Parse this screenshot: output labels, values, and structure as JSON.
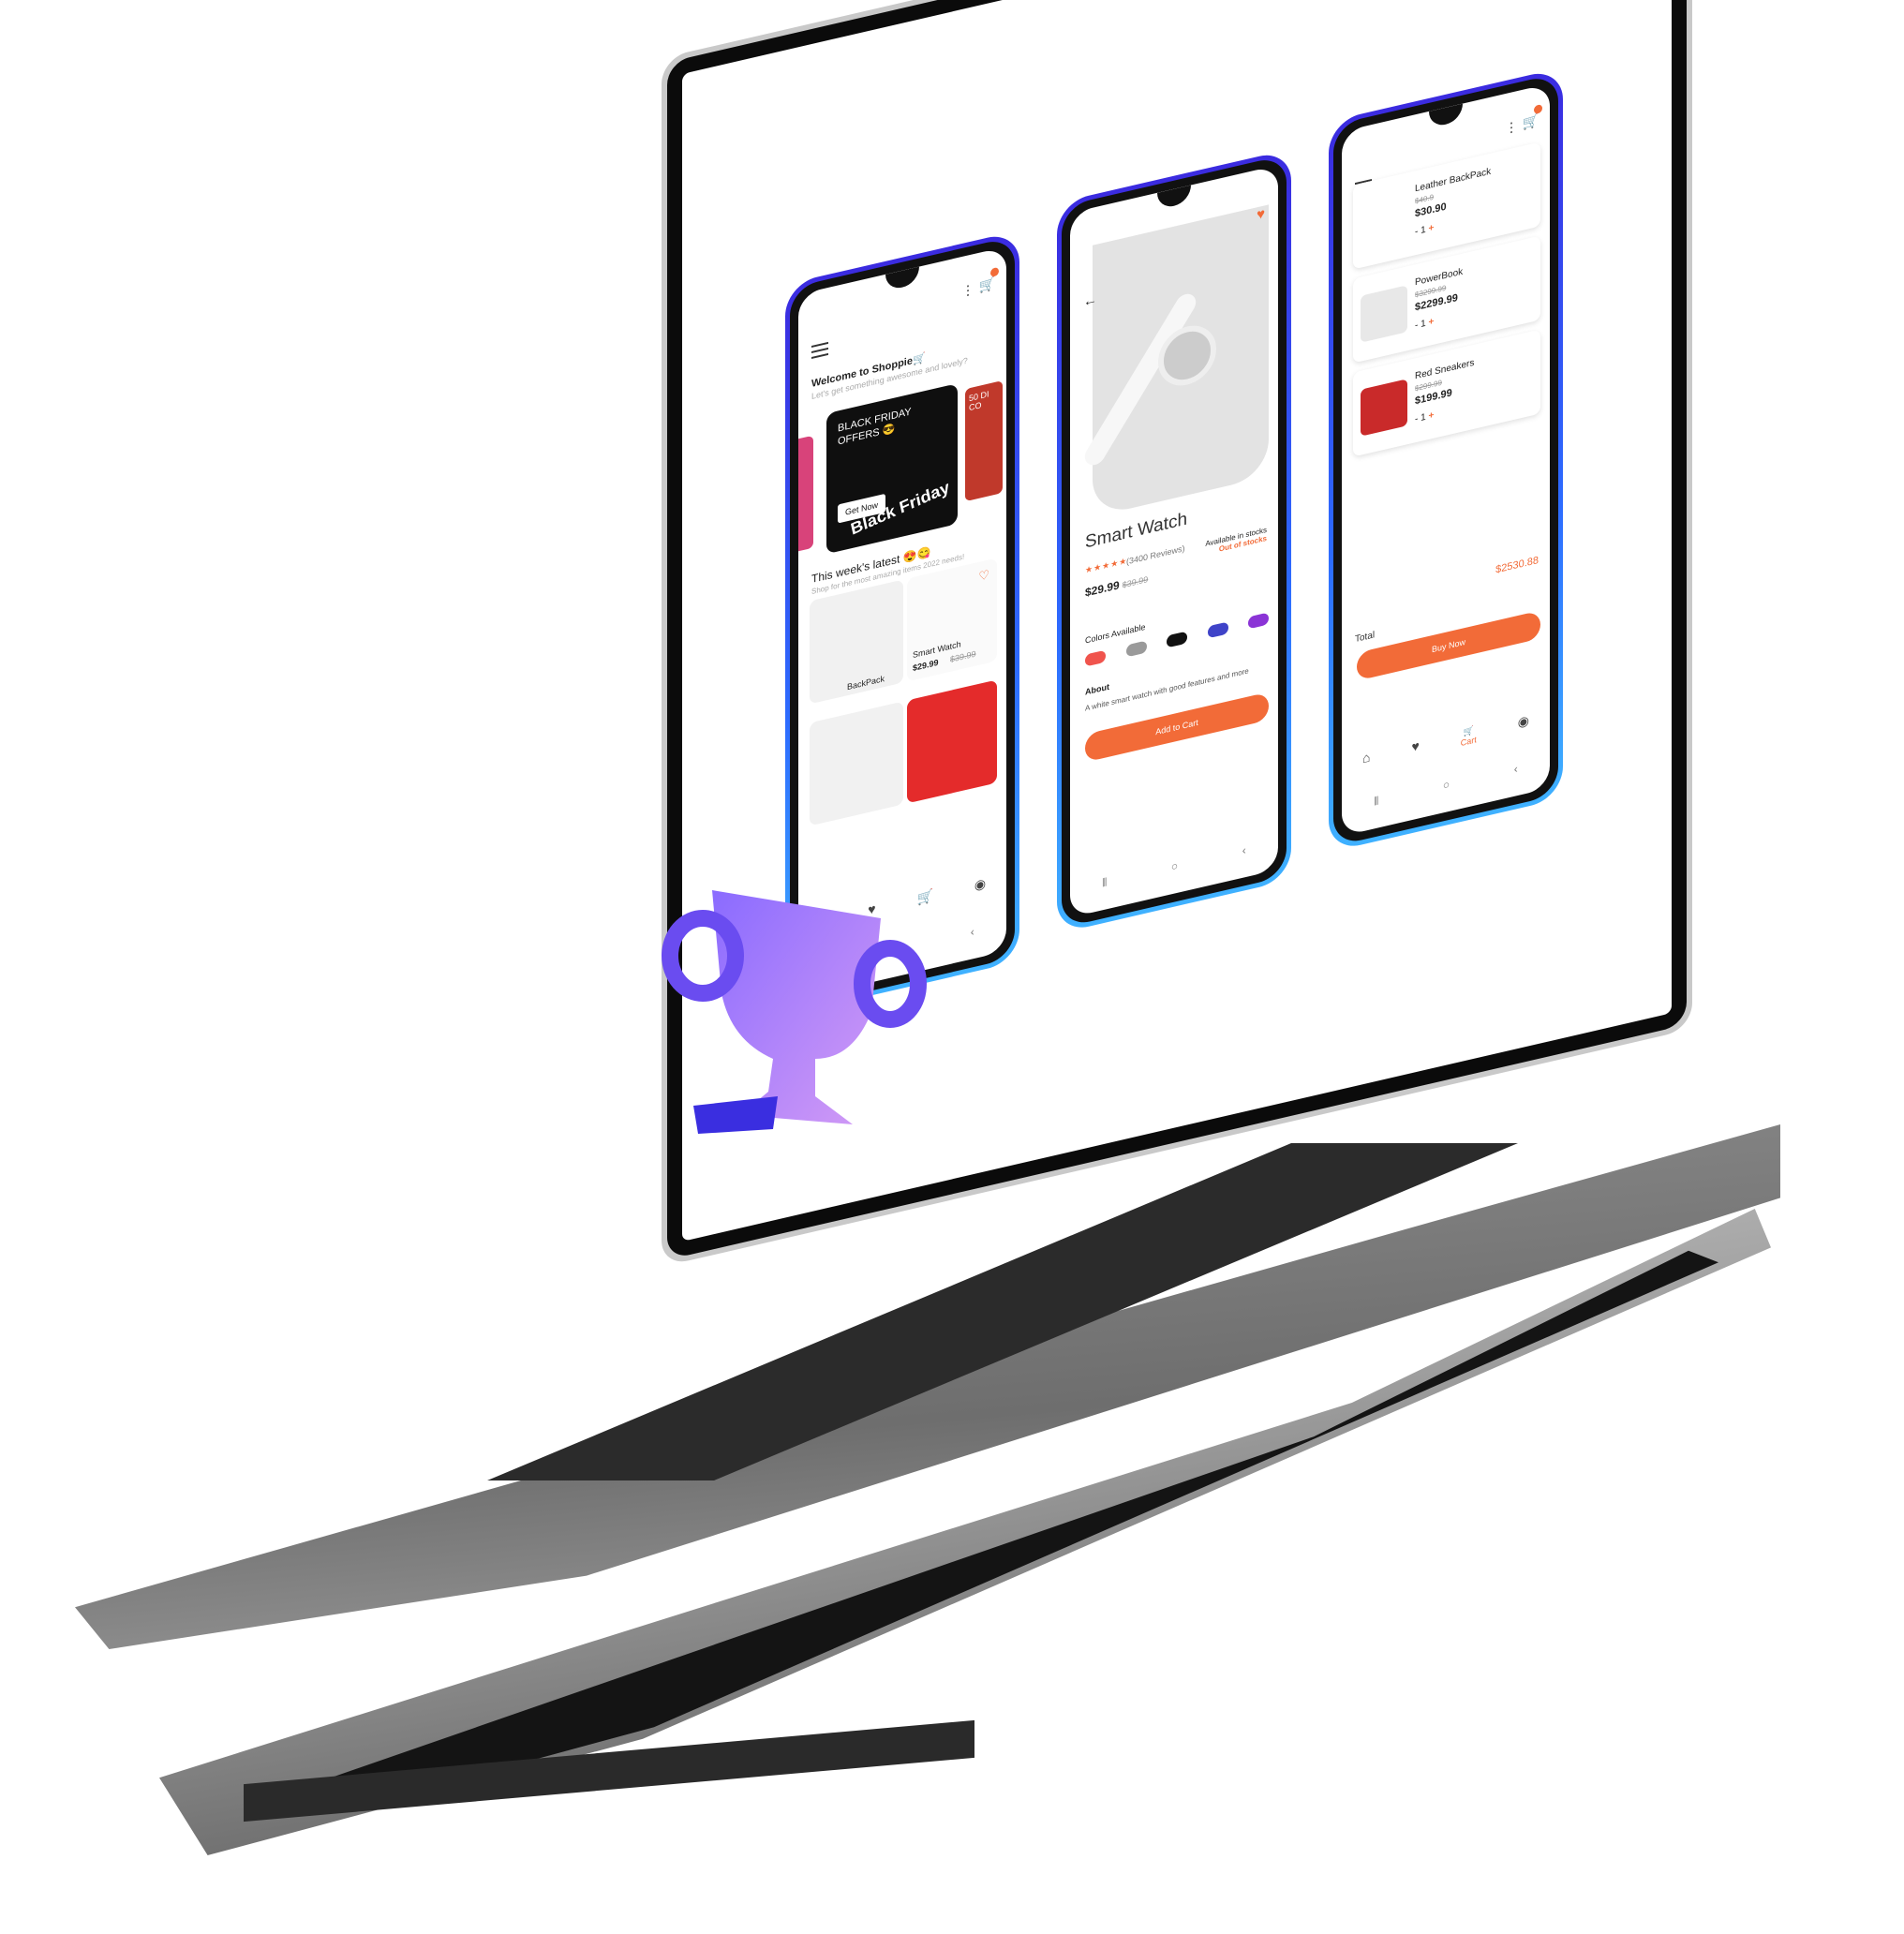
{
  "home": {
    "welcome_title": "Welcome to Shoppie🛒",
    "welcome_sub": "Let's get something awesome and lovely?",
    "banner_text": "BLACK FRIDAY OFFERS 😎",
    "banner_button": "Get Now",
    "banner_badge": "Black Friday",
    "banner_right_text": "50 DI CO",
    "latest_title": "This week's latest 😍😋",
    "latest_sub": "Shop for the most amazing items 2022 needs!",
    "item1_label": "BackPack",
    "item2_name": "Smart Watch",
    "item2_price": "$29.99",
    "item2_old": "$39.99"
  },
  "product": {
    "name": "Smart Watch",
    "stars": "★★★★★",
    "reviews": "(3400 Reviews)",
    "price": "$29.99",
    "old_price": "$39.99",
    "availability": "Available in stocks",
    "stock_status": "Out of stocks",
    "colors_label": "Colors Available",
    "colors": [
      "#f0544d",
      "#9a9a9a",
      "#111111",
      "#3f43c8",
      "#8b34d6"
    ],
    "about_label": "About",
    "about_text": "A white smart watch with good features and more",
    "add_to_cart": "Add to Cart"
  },
  "cart": {
    "items": [
      {
        "name": "Leather BackPack",
        "old": "$40.9",
        "price": "$30.90",
        "qty": "1"
      },
      {
        "name": "PowerBook",
        "old": "$3299.99",
        "price": "$2299.99",
        "qty": "1"
      },
      {
        "name": "Red Sneakers",
        "old": "$299.99",
        "price": "$199.99",
        "qty": "1"
      }
    ],
    "total_label": "Total",
    "total_value": "$2530.88",
    "buy_now": "Buy Now",
    "nav_cart": "Cart"
  },
  "icons": [
    "menu-icon",
    "kebab-icon",
    "cart-icon",
    "heart-icon",
    "back-arrow-icon",
    "home-icon",
    "user-icon",
    "trophy-icon"
  ],
  "accent": "#f26b38"
}
